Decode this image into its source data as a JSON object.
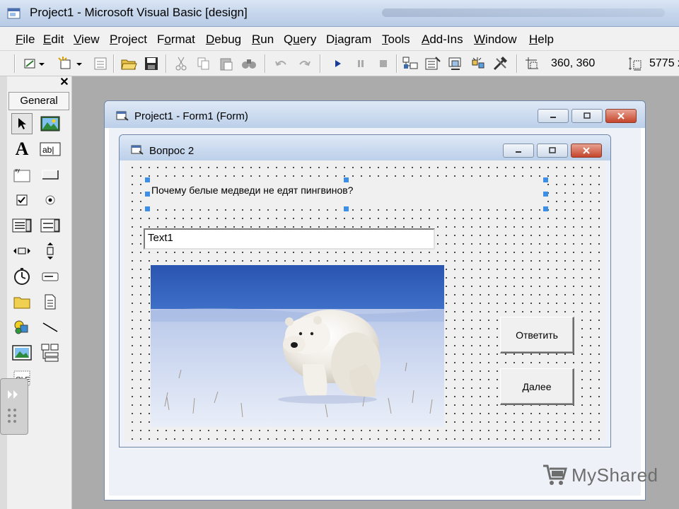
{
  "app": {
    "title": "Project1 - Microsoft Visual Basic [design]"
  },
  "menu": [
    {
      "pre": "",
      "ul": "F",
      "post": "ile"
    },
    {
      "pre": "",
      "ul": "E",
      "post": "dit"
    },
    {
      "pre": "",
      "ul": "V",
      "post": "iew"
    },
    {
      "pre": "",
      "ul": "P",
      "post": "roject"
    },
    {
      "pre": "F",
      "ul": "o",
      "post": "rmat"
    },
    {
      "pre": "",
      "ul": "D",
      "post": "ebug"
    },
    {
      "pre": "",
      "ul": "R",
      "post": "un"
    },
    {
      "pre": "Q",
      "ul": "u",
      "post": "ery"
    },
    {
      "pre": "D",
      "ul": "i",
      "post": "agram"
    },
    {
      "pre": "",
      "ul": "T",
      "post": "ools"
    },
    {
      "pre": "",
      "ul": "A",
      "post": "dd-Ins"
    },
    {
      "pre": "",
      "ul": "W",
      "post": "indow"
    },
    {
      "pre": "",
      "ul": "H",
      "post": "elp"
    }
  ],
  "toolbar": {
    "position": "360, 360",
    "size": "5775 x"
  },
  "toolbox": {
    "tab": "General"
  },
  "form_window": {
    "title": "Project1 - Form1 (Form)"
  },
  "child_window": {
    "title": "Вопрос 2"
  },
  "form": {
    "question": "Почему белые медведи не едят пингвинов?",
    "text1": "Text1",
    "answer_button": "Ответить",
    "next_button": "Далее"
  },
  "watermark": {
    "text": "MyShared"
  },
  "colors": {
    "handle": "#3c8ee6",
    "close_red": "#c5452b",
    "title_blue": "#c9d9ee"
  }
}
